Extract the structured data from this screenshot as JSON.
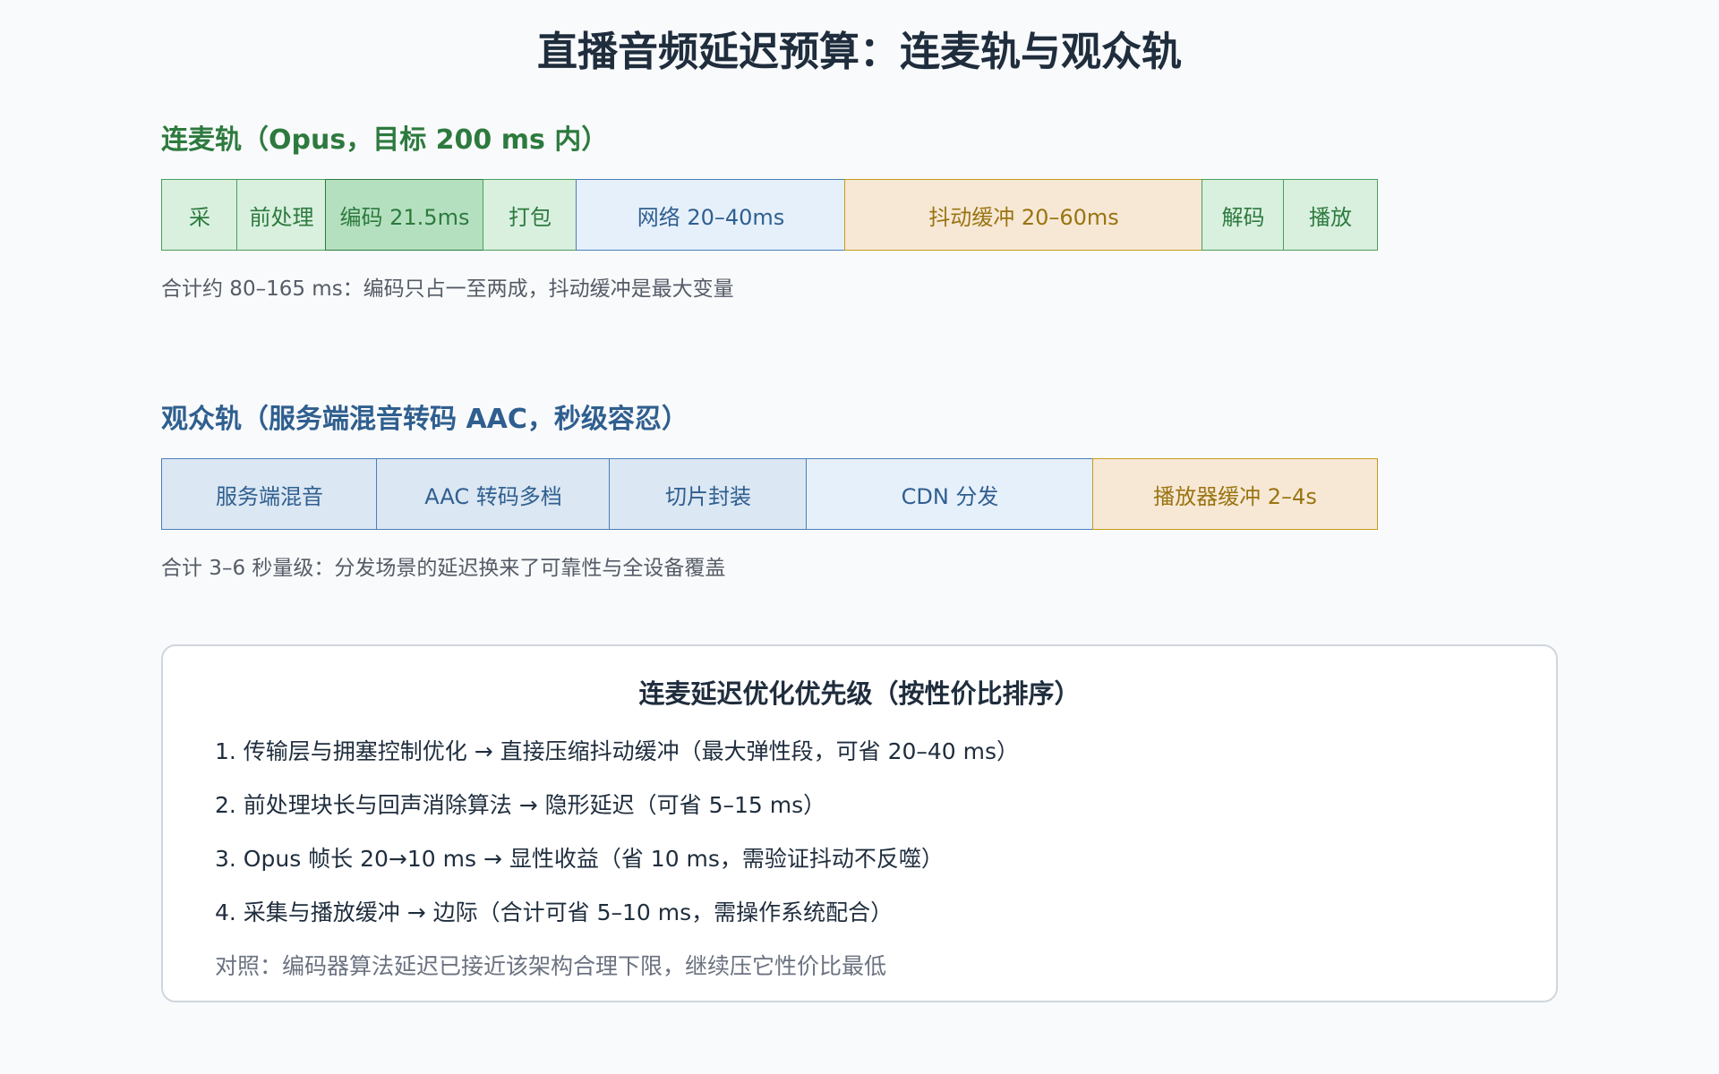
{
  "title": "直播音频延迟预算：连麦轨与观众轨",
  "mic_track": {
    "heading": "连麦轨（Opus，目标 200 ms 内）",
    "segments": [
      {
        "label": "采"
      },
      {
        "label": "前处理"
      },
      {
        "label": "编码 21.5ms"
      },
      {
        "label": "打包"
      },
      {
        "label": "网络 20–40ms"
      },
      {
        "label": "抖动缓冲 20–60ms"
      },
      {
        "label": "解码"
      },
      {
        "label": "播放"
      }
    ],
    "note": "合计约 80–165 ms：编码只占一至两成，抖动缓冲是最大变量"
  },
  "audience_track": {
    "heading": "观众轨（服务端混音转码 AAC，秒级容忍）",
    "segments": [
      {
        "label": "服务端混音"
      },
      {
        "label": "AAC 转码多档"
      },
      {
        "label": "切片封装"
      },
      {
        "label": "CDN 分发"
      },
      {
        "label": "播放器缓冲 2–4s"
      }
    ],
    "note": "合计 3–6 秒量级：分发场景的延迟换来了可靠性与全设备覆盖"
  },
  "priority_box": {
    "title": "连麦延迟优化优先级（按性价比排序）",
    "items": [
      "1. 传输层与拥塞控制优化 → 直接压缩抖动缓冲（最大弹性段，可省 20–40 ms）",
      "2. 前处理块长与回声消除算法 → 隐形延迟（可省 5–15 ms）",
      "3. Opus 帧长 20→10 ms → 显性收益（省 10 ms，需验证抖动不反噬）",
      "4. 采集与播放缓冲 → 边际（合计可省 5–10 ms，需操作系统配合）"
    ],
    "contrast": "对照：编码器算法延迟已接近该架构合理下限，继续压它性价比最低"
  },
  "colors": {
    "green_fill": "#d9f0df",
    "green_emphasis_fill": "#b5e0c0",
    "green_text": "#2d7a3e",
    "blue_fill": "#dbe7f3",
    "blue_light_fill": "#e6f0fb",
    "blue_text": "#2f5f8f",
    "orange_fill": "#f7e8d6",
    "orange_text": "#9a7410"
  }
}
